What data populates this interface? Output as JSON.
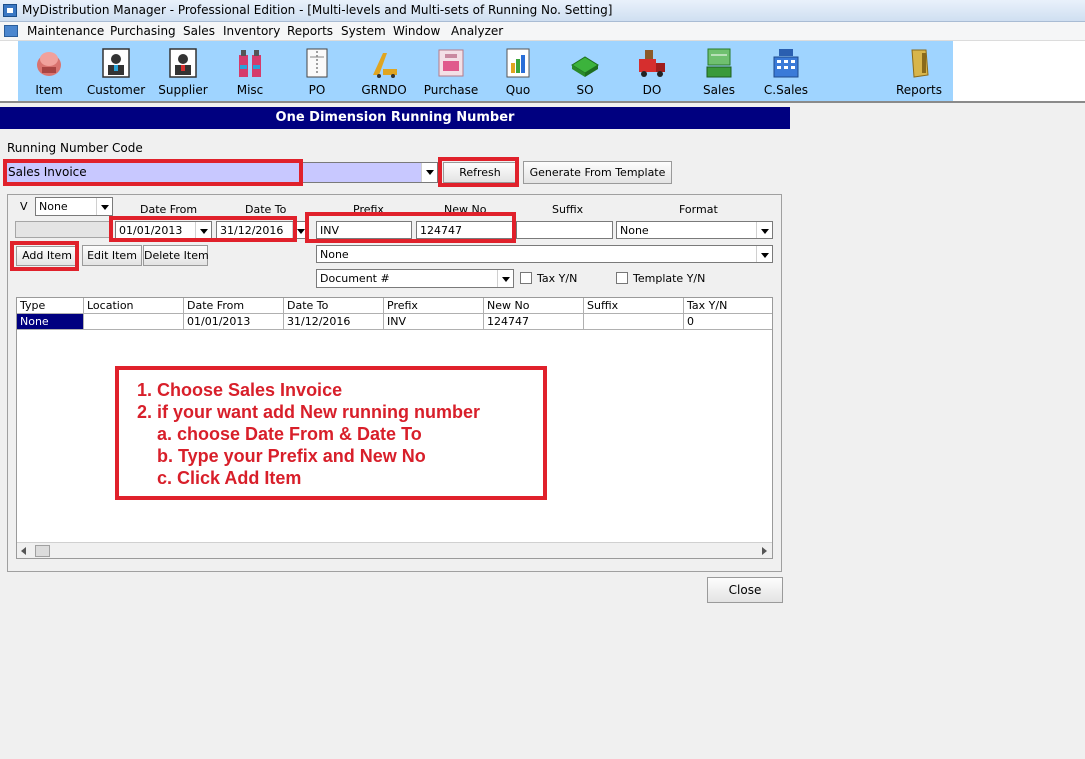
{
  "window": {
    "title": "MyDistribution Manager - Professional Edition - [Multi-levels and Multi-sets of Running No. Setting]"
  },
  "menu": [
    "Maintenance",
    "Purchasing",
    "Sales",
    "Inventory",
    "Reports",
    "System",
    "Window",
    "Analyzer"
  ],
  "toolbar": [
    {
      "label": "Item",
      "icon": "item-icon"
    },
    {
      "label": "Customer",
      "icon": "customer-icon"
    },
    {
      "label": "Supplier",
      "icon": "supplier-icon"
    },
    {
      "label": "Misc",
      "icon": "misc-icon"
    },
    {
      "label": "PO",
      "icon": "po-icon"
    },
    {
      "label": "GRNDO",
      "icon": "grndo-icon"
    },
    {
      "label": "Purchase",
      "icon": "purchase-icon"
    },
    {
      "label": "Quo",
      "icon": "quotation-icon"
    },
    {
      "label": "SO",
      "icon": "sales-order-icon"
    },
    {
      "label": "DO",
      "icon": "delivery-truck-icon"
    },
    {
      "label": "Sales",
      "icon": "sales-icon"
    },
    {
      "label": "C.Sales",
      "icon": "cash-register-icon"
    },
    {
      "label": "Reports",
      "icon": "reports-icon"
    }
  ],
  "colors": {
    "header_bg": "#000080",
    "highlight": "#e0212b",
    "toolbar_band": "#9fd4ff",
    "selected_code_bg": "#c8c8ff"
  },
  "form": {
    "header": "One Dimension Running Number",
    "code_label": "Running Number Code",
    "code_value": "Sales Invoice",
    "refresh": "Refresh",
    "generate": "Generate From Template",
    "v_label": "V",
    "v_value": "None",
    "date_from_label": "Date From",
    "date_to_label": "Date To",
    "prefix_label": "Prefix",
    "new_no_label": "New No",
    "suffix_label": "Suffix",
    "format_label": "Format",
    "date_from": "01/01/2013",
    "date_to": "31/12/2016",
    "prefix": "INV",
    "new_no": "124747",
    "suffix": "",
    "format": "None",
    "option2": "None",
    "doc_field": "Document #",
    "tax_label": "Tax Y/N",
    "template_label": "Template Y/N",
    "add_item": "Add Item",
    "edit_item": "Edit Item",
    "delete_item": "Delete Item",
    "close": "Close"
  },
  "grid": {
    "columns": [
      "Type",
      "Location",
      "Date From",
      "Date To",
      "Prefix",
      "New No",
      "Suffix",
      "Tax Y/N"
    ],
    "rows": [
      [
        "None",
        "",
        "01/01/2013",
        "31/12/2016",
        "INV",
        "124747",
        "",
        "0"
      ]
    ]
  },
  "instructions": [
    "1. Choose Sales Invoice",
    "2. if your want add New running number",
    "a. choose Date From & Date To",
    "b. Type your Prefix and New No",
    "c. Click Add Item"
  ]
}
